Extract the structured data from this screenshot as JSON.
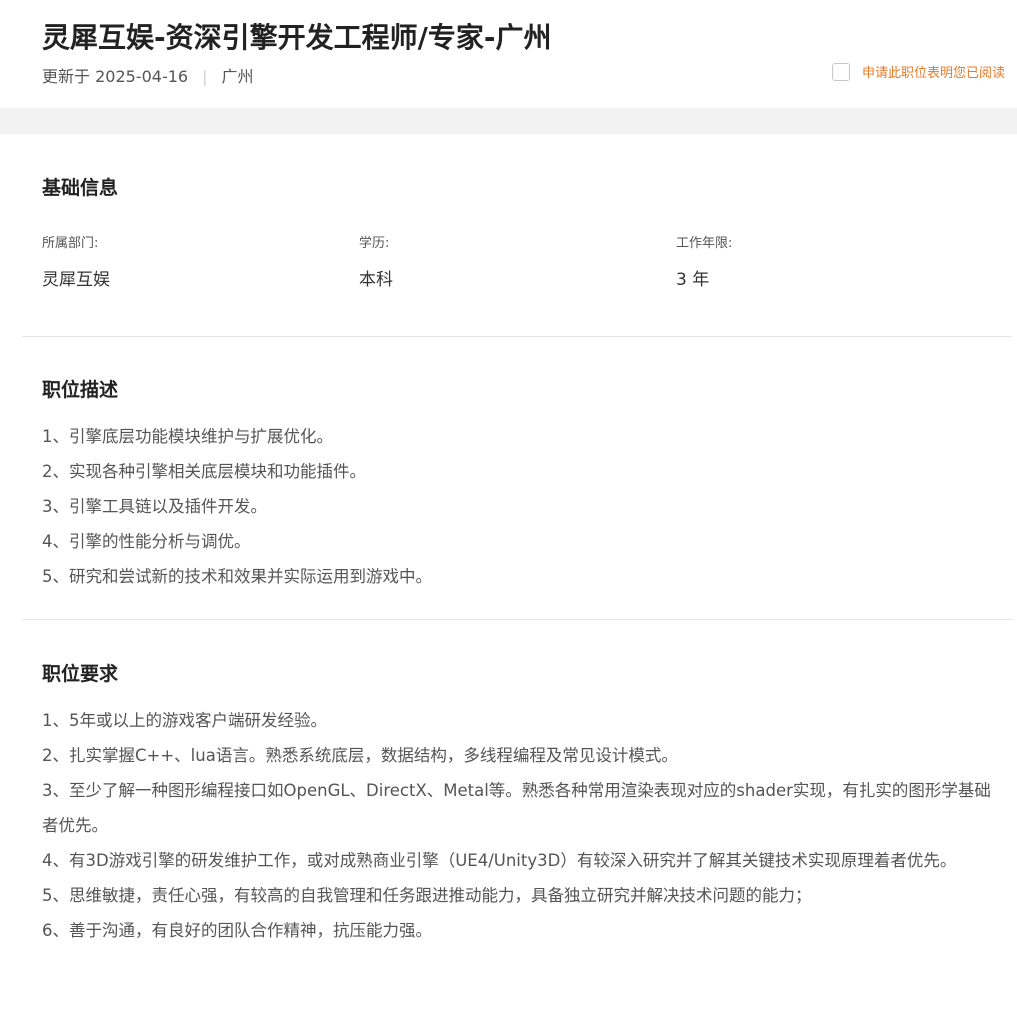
{
  "job": {
    "title": "灵犀互娱-资深引擎开发工程师/专家-广州",
    "updated": "更新于 2025-04-16",
    "separator": "|",
    "location": "广州",
    "apply_notice": "申请此职位表明您已阅读"
  },
  "basic_info": {
    "heading": "基础信息",
    "department_label": "所属部门:",
    "department_value": "灵犀互娱",
    "education_label": "学历:",
    "education_value": "本科",
    "experience_label": "工作年限:",
    "experience_value": "3 年"
  },
  "description": {
    "heading": "职位描述",
    "items": [
      "1、引擎底层功能模块维护与扩展优化。",
      "2、实现各种引擎相关底层模块和功能插件。",
      "3、引擎工具链以及插件开发。",
      "4、引擎的性能分析与调优。",
      "5、研究和尝试新的技术和效果并实际运用到游戏中。"
    ]
  },
  "requirements": {
    "heading": "职位要求",
    "items": [
      "1、5年或以上的游戏客户端研发经验。",
      "2、扎实掌握C++、lua语言。熟悉系统底层，数据结构，多线程编程及常见设计模式。",
      "3、至少了解一种图形编程接口如OpenGL、DirectX、Metal等。熟悉各种常用渲染表现对应的shader实现，有扎实的图形学基础者优先。",
      "4、有3D游戏引擎的研发维护工作，或对成熟商业引擎（UE4/Unity3D）有较深入研究并了解其关键技术实现原理着者优先。",
      "5、思维敏捷，责任心强，有较高的自我管理和任务跟进推动能力，具备独立研究并解决技术问题的能力；",
      "6、善于沟通，有良好的团队合作精神，抗压能力强。"
    ]
  },
  "colors": {
    "accent": "#e57a2a",
    "title": "#222222",
    "text": "#555555",
    "band": "#f2f2f2"
  }
}
